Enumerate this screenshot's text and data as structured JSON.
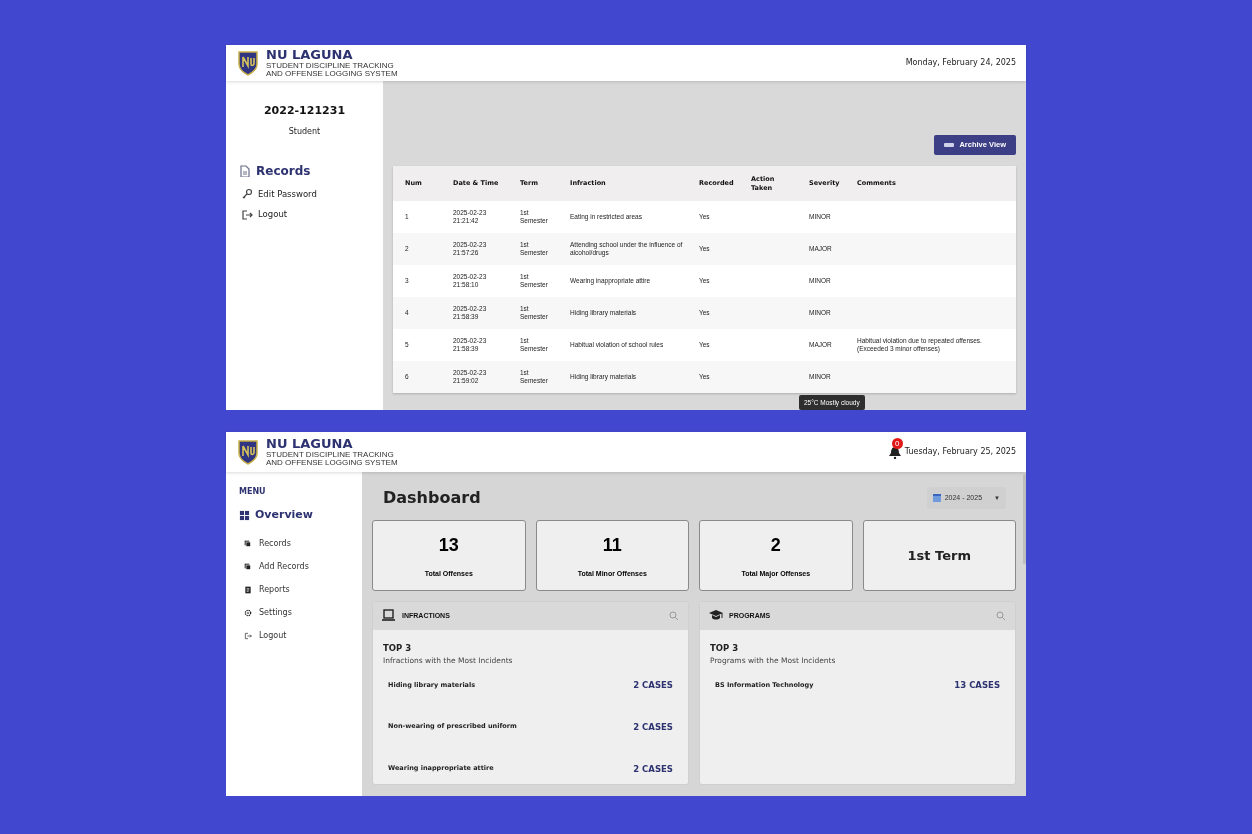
{
  "records_screen": {
    "header": {
      "brand": "NU LAGUNA",
      "subtitle_lines": [
        "STUDENT DISCIPLINE TRACKING",
        "AND OFFENSE LOGGING SYSTEM"
      ],
      "date": "Monday, February 24, 2025"
    },
    "profile": {
      "id": "2022-121231",
      "role": "Student"
    },
    "sidebar": {
      "items": [
        {
          "label": "Records",
          "selected": true,
          "kind": "document"
        },
        {
          "label": "Edit Password",
          "selected": false,
          "kind": "key"
        },
        {
          "label": "Logout",
          "selected": false,
          "kind": "logout"
        }
      ]
    },
    "archive_button": "Archive View",
    "table": {
      "columns": [
        "Num",
        "Date & Time",
        "Term",
        "Infraction",
        "Recorded",
        "Action\nTaken",
        "Severity",
        "Comments"
      ],
      "rows": [
        [
          "1",
          "2025-02-23\n21:21:42",
          "1st\nSemester",
          "Eating in restricted areas",
          "Yes",
          "",
          "MINOR",
          ""
        ],
        [
          "2",
          "2025-02-23\n21:57:26",
          "1st\nSemester",
          "Attending school under the influence of alcohol/drugs",
          "Yes",
          "",
          "MAJOR",
          ""
        ],
        [
          "3",
          "2025-02-23\n21:58:10",
          "1st\nSemester",
          "Wearing inappropriate attire",
          "Yes",
          "",
          "MINOR",
          ""
        ],
        [
          "4",
          "2025-02-23\n21:58:39",
          "1st\nSemester",
          "Hiding library materials",
          "Yes",
          "",
          "MINOR",
          ""
        ],
        [
          "5",
          "2025-02-23\n21:58:39",
          "1st\nSemester",
          "Habitual violation of school rules",
          "Yes",
          "",
          "MAJOR",
          "Habitual violation due to repeated offenses.\n(Exceeded 3 minor offenses)"
        ],
        [
          "6",
          "2025-02-23\n21:59:02",
          "1st\nSemester",
          "Hiding library materials",
          "Yes",
          "",
          "MINOR",
          ""
        ]
      ]
    },
    "tooltip": "25°C Mostly cloudy"
  },
  "dashboard_screen": {
    "header": {
      "brand": "NU LAGUNA",
      "subtitle_lines": [
        "STUDENT DISCIPLINE TRACKING",
        "AND OFFENSE LOGGING SYSTEM"
      ],
      "notification_count": "0",
      "date": "Tuesday, February 25, 2025"
    },
    "sidebar": {
      "heading": "MENU",
      "items": [
        {
          "label": "Overview",
          "selected": true,
          "kind": "grid"
        },
        {
          "label": "Records",
          "selected": false,
          "kind": "copy"
        },
        {
          "label": "Add Records",
          "selected": false,
          "kind": "copy"
        },
        {
          "label": "Reports",
          "selected": false,
          "kind": "report"
        },
        {
          "label": "Settings",
          "selected": false,
          "kind": "gear"
        },
        {
          "label": "Logout",
          "selected": false,
          "kind": "logout"
        }
      ]
    },
    "title": "Dashboard",
    "year_select": {
      "value": "2024 - 2025",
      "caret": "▼"
    },
    "cards": [
      {
        "kind": "stat",
        "value": "13",
        "label": "Total Offenses"
      },
      {
        "kind": "stat",
        "value": "11",
        "label": "Total Minor Offenses"
      },
      {
        "kind": "stat",
        "value": "2",
        "label": "Total Major Offenses"
      },
      {
        "kind": "term",
        "value": "1st Term"
      }
    ],
    "panels": [
      {
        "kind": "laptop",
        "title": "INFRACTIONS",
        "heading": "TOP 3",
        "subtitle": "Infractions with the Most Incidents",
        "items": [
          {
            "label": "Hiding library materials",
            "count": "2 CASES"
          },
          {
            "label": "Non-wearing of prescribed uniform",
            "count": "2 CASES"
          },
          {
            "label": "Wearing inappropriate attire",
            "count": "2 CASES"
          }
        ]
      },
      {
        "kind": "cap",
        "title": "PROGRAMS",
        "heading": "TOP 3",
        "subtitle": "Programs with the Most Incidents",
        "items": [
          {
            "label": "BS Information Technology",
            "count": "13 CASES"
          }
        ]
      }
    ]
  }
}
